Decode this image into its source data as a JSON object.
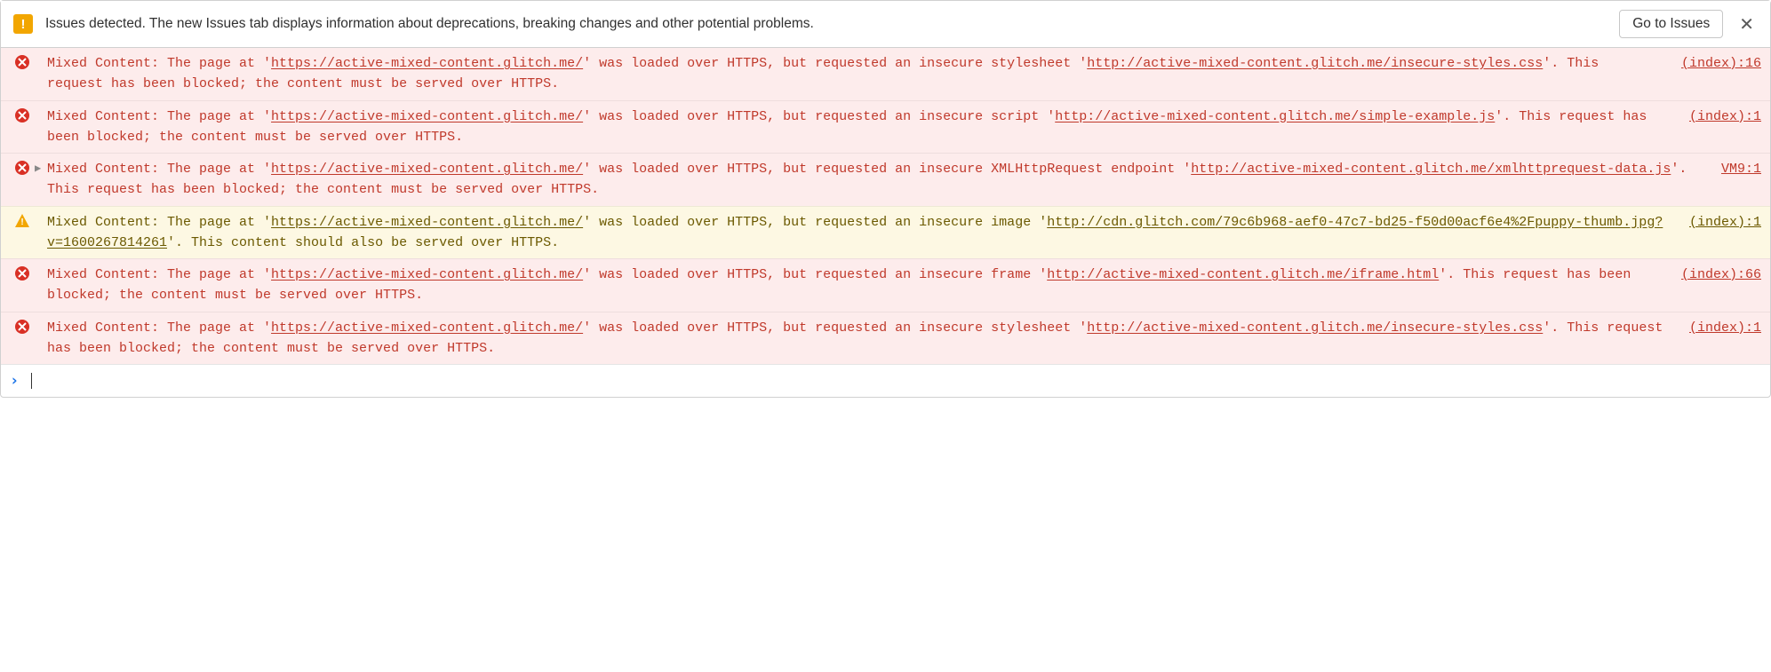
{
  "issues_bar": {
    "badge_glyph": "!",
    "text": "Issues detected. The new Issues tab displays information about deprecations, breaking changes and other potential problems.",
    "button_label": "Go to Issues",
    "close_glyph": "✕"
  },
  "messages": [
    {
      "level": "error",
      "expandable": false,
      "source": "(index):16",
      "segments": [
        {
          "t": "text",
          "v": "Mixed Content: The page at '"
        },
        {
          "t": "url",
          "v": "https://active-mixed-content.glitch.me/"
        },
        {
          "t": "text",
          "v": "' was loaded over HTTPS, but requested an insecure stylesheet '"
        },
        {
          "t": "url",
          "v": "http://active-mixed-content.glitch.me/insecure-styles.css"
        },
        {
          "t": "text",
          "v": "'. This request has been blocked; the content must be served over HTTPS."
        }
      ]
    },
    {
      "level": "error",
      "expandable": false,
      "source": "(index):1",
      "segments": [
        {
          "t": "text",
          "v": "Mixed Content: The page at '"
        },
        {
          "t": "url",
          "v": "https://active-mixed-content.glitch.me/"
        },
        {
          "t": "text",
          "v": "' was loaded over HTTPS, but requested an insecure script '"
        },
        {
          "t": "url",
          "v": "http://active-mixed-content.glitch.me/simple-example.js"
        },
        {
          "t": "text",
          "v": "'. This request has been blocked; the content must be served over HTTPS."
        }
      ]
    },
    {
      "level": "error",
      "expandable": true,
      "source": "VM9:1",
      "segments": [
        {
          "t": "text",
          "v": "Mixed Content: The page at '"
        },
        {
          "t": "url",
          "v": "https://active-mixed-content.glitch.me/"
        },
        {
          "t": "text",
          "v": "' was loaded over HTTPS, but requested an insecure XMLHttpRequest endpoint '"
        },
        {
          "t": "url",
          "v": "http://active-mixed-content.glitch.me/xmlhttprequest-data.js"
        },
        {
          "t": "text",
          "v": "'. This request has been blocked; the content must be served over HTTPS."
        }
      ]
    },
    {
      "level": "warning",
      "expandable": false,
      "source": "(index):1",
      "segments": [
        {
          "t": "text",
          "v": "Mixed Content: The page at '"
        },
        {
          "t": "url",
          "v": "https://active-mixed-content.glitch.me/"
        },
        {
          "t": "text",
          "v": "' was loaded over HTTPS, but requested an insecure image '"
        },
        {
          "t": "url",
          "v": "http://cdn.glitch.com/79c6b968-aef0-47c7-bd25-f50d00acf6e4%2Fpuppy-thumb.jpg?v=1600267814261"
        },
        {
          "t": "text",
          "v": "'. This content should also be served over HTTPS."
        }
      ]
    },
    {
      "level": "error",
      "expandable": false,
      "source": "(index):66",
      "segments": [
        {
          "t": "text",
          "v": "Mixed Content: The page at '"
        },
        {
          "t": "url",
          "v": "https://active-mixed-content.glitch.me/"
        },
        {
          "t": "text",
          "v": "' was loaded over HTTPS, but requested an insecure frame '"
        },
        {
          "t": "url",
          "v": "http://active-mixed-content.glitch.me/iframe.html"
        },
        {
          "t": "text",
          "v": "'. This request has been blocked; the content must be served over HTTPS."
        }
      ]
    },
    {
      "level": "error",
      "expandable": false,
      "source": "(index):1",
      "segments": [
        {
          "t": "text",
          "v": "Mixed Content: The page at '"
        },
        {
          "t": "url",
          "v": "https://active-mixed-content.glitch.me/"
        },
        {
          "t": "text",
          "v": "' was loaded over HTTPS, but requested an insecure stylesheet '"
        },
        {
          "t": "url",
          "v": "http://active-mixed-content.glitch.me/insecure-styles.css"
        },
        {
          "t": "text",
          "v": "'. This request has been blocked; the content must be served over HTTPS."
        }
      ]
    }
  ],
  "prompt": {
    "chevron": "›"
  }
}
